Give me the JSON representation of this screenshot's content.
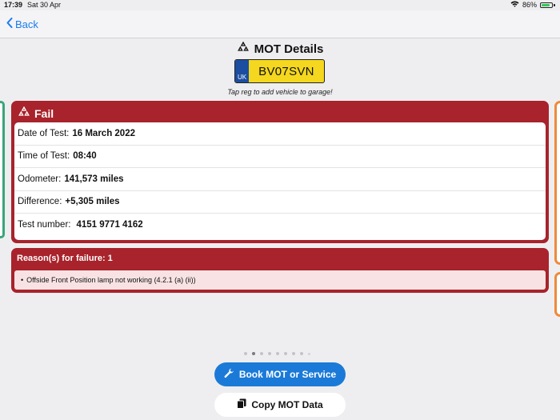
{
  "status_bar": {
    "time": "17:39",
    "date": "Sat 30 Apr",
    "battery": "86%",
    "battery_level": 0.86
  },
  "nav": {
    "back_label": "Back"
  },
  "header": {
    "title": "MOT Details",
    "plate_country": "UK",
    "plate_reg": "BV07SVN",
    "tap_hint": "Tap reg to add vehicle to garage!"
  },
  "result": {
    "status": "Fail",
    "rows": [
      {
        "label": "Date of Test:",
        "value": "16 March 2022"
      },
      {
        "label": "Time of Test:",
        "value": "08:40"
      },
      {
        "label": "Odometer:",
        "value": "141,573 miles"
      },
      {
        "label": "Difference:",
        "value": "+5,305 miles"
      },
      {
        "label": "Test number:",
        "value": "4151 9771 4162"
      }
    ]
  },
  "failure": {
    "title": "Reason(s) for failure: 1",
    "items": [
      "Offside Front Position lamp not working (4.2.1 (a) (ii))"
    ]
  },
  "pager": {
    "count": 9,
    "active": 1
  },
  "actions": {
    "book_label": "Book MOT or Service",
    "copy_label": "Copy MOT Data"
  },
  "colors": {
    "fail": "#a8232b",
    "accent": "#1b7ad8",
    "plate": "#f4d71e",
    "pass": "#3aa57a",
    "advisory": "#ef8a3a"
  }
}
